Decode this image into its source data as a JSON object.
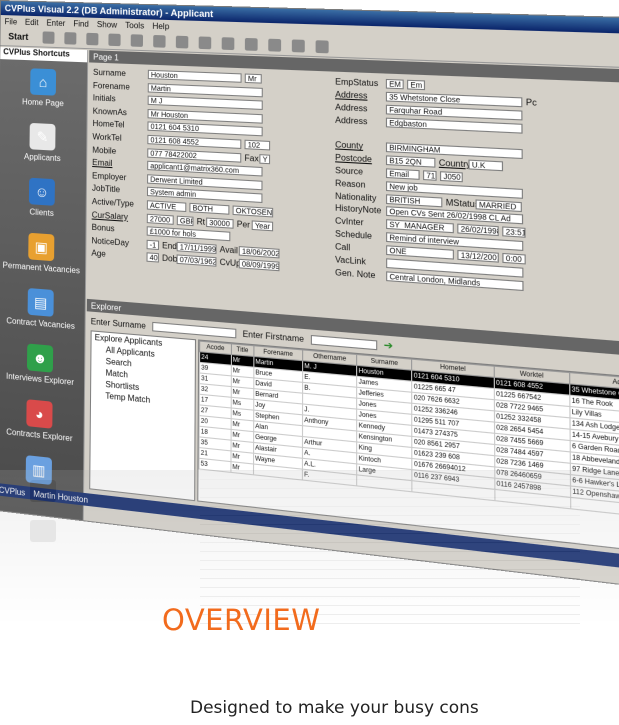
{
  "window": {
    "title": "CVPlus Visual 2.2 (DB Administrator) - Applicant"
  },
  "menu": [
    "File",
    "Edit",
    "Enter",
    "Find",
    "Show",
    "Tools",
    "Help"
  ],
  "toolbar": {
    "start_label": "Start"
  },
  "shortcuts": {
    "title": "CVPlus Shortcuts",
    "items": [
      {
        "label": "Home Page",
        "icon": "home-icon",
        "color": "#3b8fd6"
      },
      {
        "label": "Applicants",
        "icon": "applicants-icon",
        "color": "#e8e8e8"
      },
      {
        "label": "Clients",
        "icon": "clients-icon",
        "color": "#2f73c4"
      },
      {
        "label": "Permanent Vacancies",
        "icon": "permanent-vacancies-icon",
        "color": "#e8a030"
      },
      {
        "label": "Contract Vacancies",
        "icon": "contract-vacancies-icon",
        "color": "#4a90d9"
      },
      {
        "label": "Interviews Explorer",
        "icon": "interviews-icon",
        "color": "#2fa04a"
      },
      {
        "label": "Contracts Explorer",
        "icon": "contracts-icon",
        "color": "#d94a4a"
      },
      {
        "label": "Diary",
        "icon": "diary-icon",
        "color": "#6aa0e0"
      }
    ]
  },
  "page": {
    "label": "Page 1"
  },
  "form": {
    "surname_label": "Surname",
    "surname": "Houston",
    "title": "Mr",
    "forename_label": "Forename",
    "forename": "Martin",
    "initials_label": "Initials",
    "initials": "M J",
    "knownas_label": "KnownAs",
    "knownas": "Mr Houston",
    "hometel_label": "HomeTel",
    "hometel": "0121 604 5310",
    "worktel_label": "WorkTel",
    "worktel": "0121 608 4552",
    "ext": "102",
    "mobile_label": "Mobile",
    "mobile": "077 78422002",
    "fax_label": "Fax",
    "fax": "Y",
    "email_label": "Email",
    "email": "applicant1@matrix360.com",
    "employer_label": "Employer",
    "employer": "Derwent Limited",
    "jobtitle_label": "JobTitle",
    "jobtitle": "System admin",
    "activetype_label": "Active/Type",
    "active": "ACTIVE",
    "type": "BOTH",
    "type2": "OKTOSEND",
    "cursalary_label": "CurSalary",
    "cursalary": "27000",
    "currency": "GBP",
    "rate_label": "Rt",
    "rate": "30000",
    "per_label": "Per",
    "per": "Year",
    "bonus_label": "Bonus",
    "bonus": "£1000 for hols",
    "noticeday_label": "NoticeDay",
    "noticeday": "-1",
    "end_label": "End",
    "end": "17/11/1999",
    "avail_label": "Avail",
    "avail": "18/06/2002",
    "age_label": "Age",
    "age": "40",
    "dob_label": "Dob",
    "dob": "07/03/1962",
    "cvupd_label": "CvUpd",
    "cvupd": "08/09/1999",
    "empstatus_label": "EmpStatus",
    "empstatus": "EM",
    "empstatus2": "Em",
    "address_label": "Address",
    "address1": "35 Whetstone Close",
    "address2": "Farquhar Road",
    "address3": "Edgbaston",
    "pc_label": "Pc",
    "county_label": "County",
    "county": "BIRMINGHAM",
    "postcode_label": "Postcode",
    "postcode": "B15 2QN",
    "country_label": "Country",
    "country": "U.K",
    "source_label": "Source",
    "source": "Email",
    "source2": "71",
    "source3": "J050",
    "reason_label": "Reason",
    "reason": "New job",
    "nationality_label": "Nationality",
    "nationality": "BRITISH",
    "mstatus_label": "MStatus",
    "mstatus": "MARRIED",
    "historynote_label": "HistoryNote",
    "historynote": "Open CVs Sent 26/02/1998 CL Ad",
    "cvinter_label": "CvInter",
    "cvinter": "SY_MANAGER",
    "cvinter_date": "26/02/1998",
    "cvinter_time": "23:51",
    "schedule_label": "Schedule",
    "schedule": "Remind of interview",
    "call_label": "Call",
    "call": "ONE",
    "call_date": "13/12/2001",
    "call_time": "0:00",
    "vaclink_label": "VacLink",
    "vaclink": "",
    "gennote_label": "Gen. Note",
    "gennote": "Central London, Midlands"
  },
  "explorer": {
    "label": "Explorer",
    "surname_label": "Enter Surname",
    "firstname_label": "Enter Firstname",
    "tree": [
      "Explore Applicants",
      "All Applicants",
      "Search",
      "Match",
      "Shortlists",
      "Temp Match"
    ],
    "columns": [
      "Acode",
      "Title",
      "Forename",
      "Othername",
      "Surname",
      "Hometel",
      "Worktel",
      "Addr"
    ],
    "rows": [
      [
        "24",
        "Mr",
        "Martin",
        "M. J",
        "Houston",
        "0121 604 5310",
        "0121 608 4552",
        "35 Whetstone Clos"
      ],
      [
        "39",
        "Mr",
        "Bruce",
        "E.",
        "James",
        "01225 665 47",
        "01225 667542",
        "16 The Rook"
      ],
      [
        "31",
        "Mr",
        "David",
        "B.",
        "Jefferies",
        "020 7626 6632",
        "028 7722 9465",
        "Lily Villas"
      ],
      [
        "32",
        "Mr",
        "Bernard",
        "",
        "Jones",
        "01252 336246",
        "01252 332458",
        "134 Ash Lodge Driv"
      ],
      [
        "17",
        "Ms",
        "Joy",
        "J.",
        "Jones",
        "01295 511 707",
        "028 2654 5454",
        "14-15 Avebury Clo"
      ],
      [
        "27",
        "Ms",
        "Stephen",
        "Anthony",
        "Kennedy",
        "01473 274375",
        "028 7455 5669",
        "6 Garden Road"
      ],
      [
        "20",
        "Mr",
        "Alan",
        "",
        "Kensington",
        "020 8561 2957",
        "028 7484 4597",
        "18 Abbevelands Clo"
      ],
      [
        "18",
        "Mr",
        "George",
        "Arthur",
        "King",
        "01623 239 608",
        "028 7236 1469",
        "97 Ridge Lane"
      ],
      [
        "35",
        "Mr",
        "Alastair",
        "A.",
        "Kintoch",
        "01676 26694012",
        "078 26460659",
        "6-6 Hawker's Lane"
      ],
      [
        "21",
        "Mr",
        "Wayne",
        "A.L.",
        "Large",
        "0116 237 6943",
        "0116 2457898",
        "112 Openshaw Lan"
      ],
      [
        "53",
        "Mr",
        "",
        "F.",
        "",
        "",
        "",
        ""
      ]
    ]
  },
  "status": {
    "app": "CVPlus",
    "user": "Martin Houston"
  },
  "overview": "OVERVIEW",
  "tagline": "Designed to make your busy cons"
}
